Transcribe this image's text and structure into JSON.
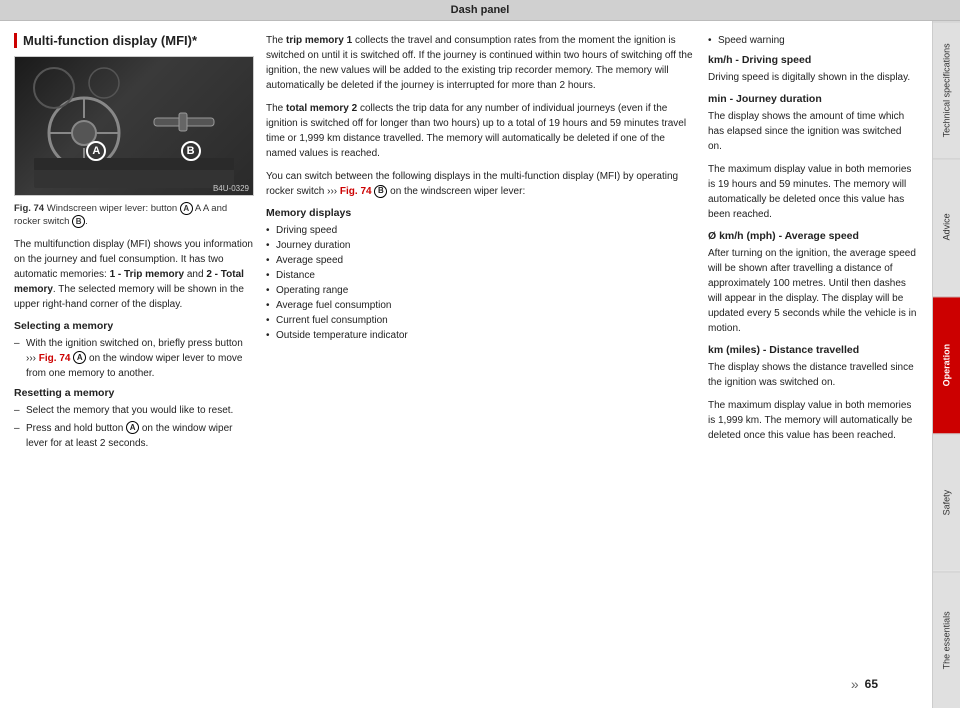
{
  "header": {
    "title": "Dash panel"
  },
  "sidebar": {
    "tabs": [
      {
        "label": "Technical specifications",
        "active": false
      },
      {
        "label": "Advice",
        "active": false
      },
      {
        "label": "Operation",
        "active": true
      },
      {
        "label": "Safety",
        "active": false
      },
      {
        "label": "The essentials",
        "active": false
      }
    ]
  },
  "section": {
    "title": "Multi-function display (MFI)*",
    "figure": {
      "caption_prefix": "Fig. 74",
      "caption_text": "Windscreen wiper lever: button",
      "caption_A": "A",
      "caption_suffix": "A and rocker switch",
      "caption_B": "B",
      "caption_end": ".",
      "fig_code": "B4U-0329"
    },
    "left_body": "The multifunction display (MFI) shows you information on the journey and fuel consumption. It has two automatic memories: ",
    "left_body_bold": "1 - Trip memory",
    "left_body2": " and ",
    "left_body_bold2": "2 - Total memory",
    "left_body3": ". The selected memory will be shown in the upper right-hand corner of the display.",
    "selecting_title": "Selecting a memory",
    "selecting_item1_prefix": "With the ignition switched on, briefly press button ››› ",
    "selecting_fig": "Fig. 74",
    "selecting_item1_suffix": " on the window wiper lever to move from one memory to another.",
    "resetting_title": "Resetting a memory",
    "resetting_item1": "Select the memory that you would like to reset.",
    "resetting_item2": "Press and hold button",
    "resetting_item2_suffix": " on the window wiper lever for at least 2 seconds."
  },
  "middle": {
    "trip_memory_para1_prefix": "The ",
    "trip_memory_bold": "trip memory 1",
    "trip_memory_para1": " collects the travel and consumption rates from the moment the ignition is switched on until it is switched off. If the journey is continued within two hours of switching off the ignition, the new values will be added to the existing trip recorder memory. The memory will automatically be deleted if the journey is interrupted for more than 2 hours.",
    "total_memory_prefix": "The ",
    "total_memory_bold": "total memory 2",
    "total_memory_para": " collects the trip data for any number of individual journeys (even if the ignition is switched off for longer than two hours) up to a total of 19 hours and 59 minutes travel time or 1,999 km distance travelled. The memory will automatically be deleted if one of the named values is reached.",
    "switch_para": "You can switch between the following displays in the multi-function display (MFI) by operating rocker switch ››› ",
    "switch_fig": "Fig. 74",
    "switch_para2": " on the windscreen wiper lever:",
    "memory_displays_title": "Memory displays",
    "memory_items": [
      "Driving speed",
      "Journey duration",
      "Average speed",
      "Distance",
      "Operating range",
      "Average fuel consumption",
      "Current fuel consumption",
      "Outside temperature indicator"
    ]
  },
  "right": {
    "bullet_item": "Speed warning",
    "kmh_title": "km/h - Driving speed",
    "kmh_body": "Driving speed is digitally shown in the display.",
    "min_title": "min - Journey duration",
    "min_body": "The display shows the amount of time which has elapsed since the ignition was switched on.",
    "min_body2": "The maximum display value in both memories is 19 hours and 59 minutes. The memory will automatically be deleted once this value has been reached.",
    "avg_title": "Ø km/h (mph) - Average speed",
    "avg_body": "After turning on the ignition, the average speed will be shown after travelling a distance of approximately 100 metres. Until then dashes will appear in the display. The display will be updated every 5 seconds while the vehicle is in motion.",
    "km_title": "km (miles) - Distance travelled",
    "km_body": "The display shows the distance travelled since the ignition was switched on.",
    "km_body2": "The maximum display value in both memories is 1,999 km. The memory will automatically be deleted once this value has been reached."
  },
  "footer": {
    "arrow": "»",
    "page_number": "65"
  }
}
